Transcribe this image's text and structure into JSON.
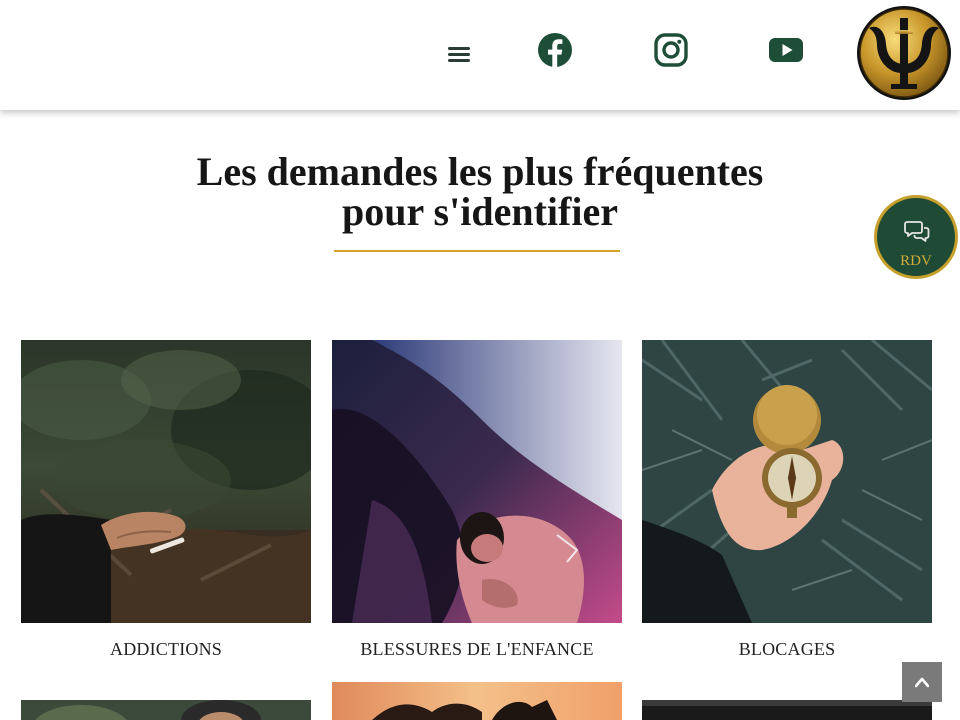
{
  "header": {
    "menu_icon": "hamburger-menu-icon",
    "social": [
      {
        "name": "facebook",
        "icon": "facebook-icon"
      },
      {
        "name": "instagram",
        "icon": "instagram-icon"
      },
      {
        "name": "youtube",
        "icon": "youtube-icon"
      }
    ],
    "logo_icon": "psi-logo-icon",
    "colors": {
      "icon": "#1e4d38",
      "gold": "#d4a52a"
    }
  },
  "section": {
    "title_line1": "Les demandes les plus fréquentes",
    "title_line2": "pour s'identifier"
  },
  "rdv": {
    "label": "RDV",
    "icon": "chat-bubbles-icon",
    "bg": "#1f4a36",
    "border": "#c7a02b"
  },
  "cards": [
    {
      "title": "ADDICTIONS",
      "image": "hand-holding-cigarette-in-forest"
    },
    {
      "title": "BLESSURES DE L'ENFANCE",
      "image": "bare-shouldered-person-in-purple-light"
    },
    {
      "title": "BLOCAGES",
      "image": "hand-holding-compass-over-pine"
    }
  ],
  "scroll_top": {
    "icon": "chevron-up-icon"
  }
}
